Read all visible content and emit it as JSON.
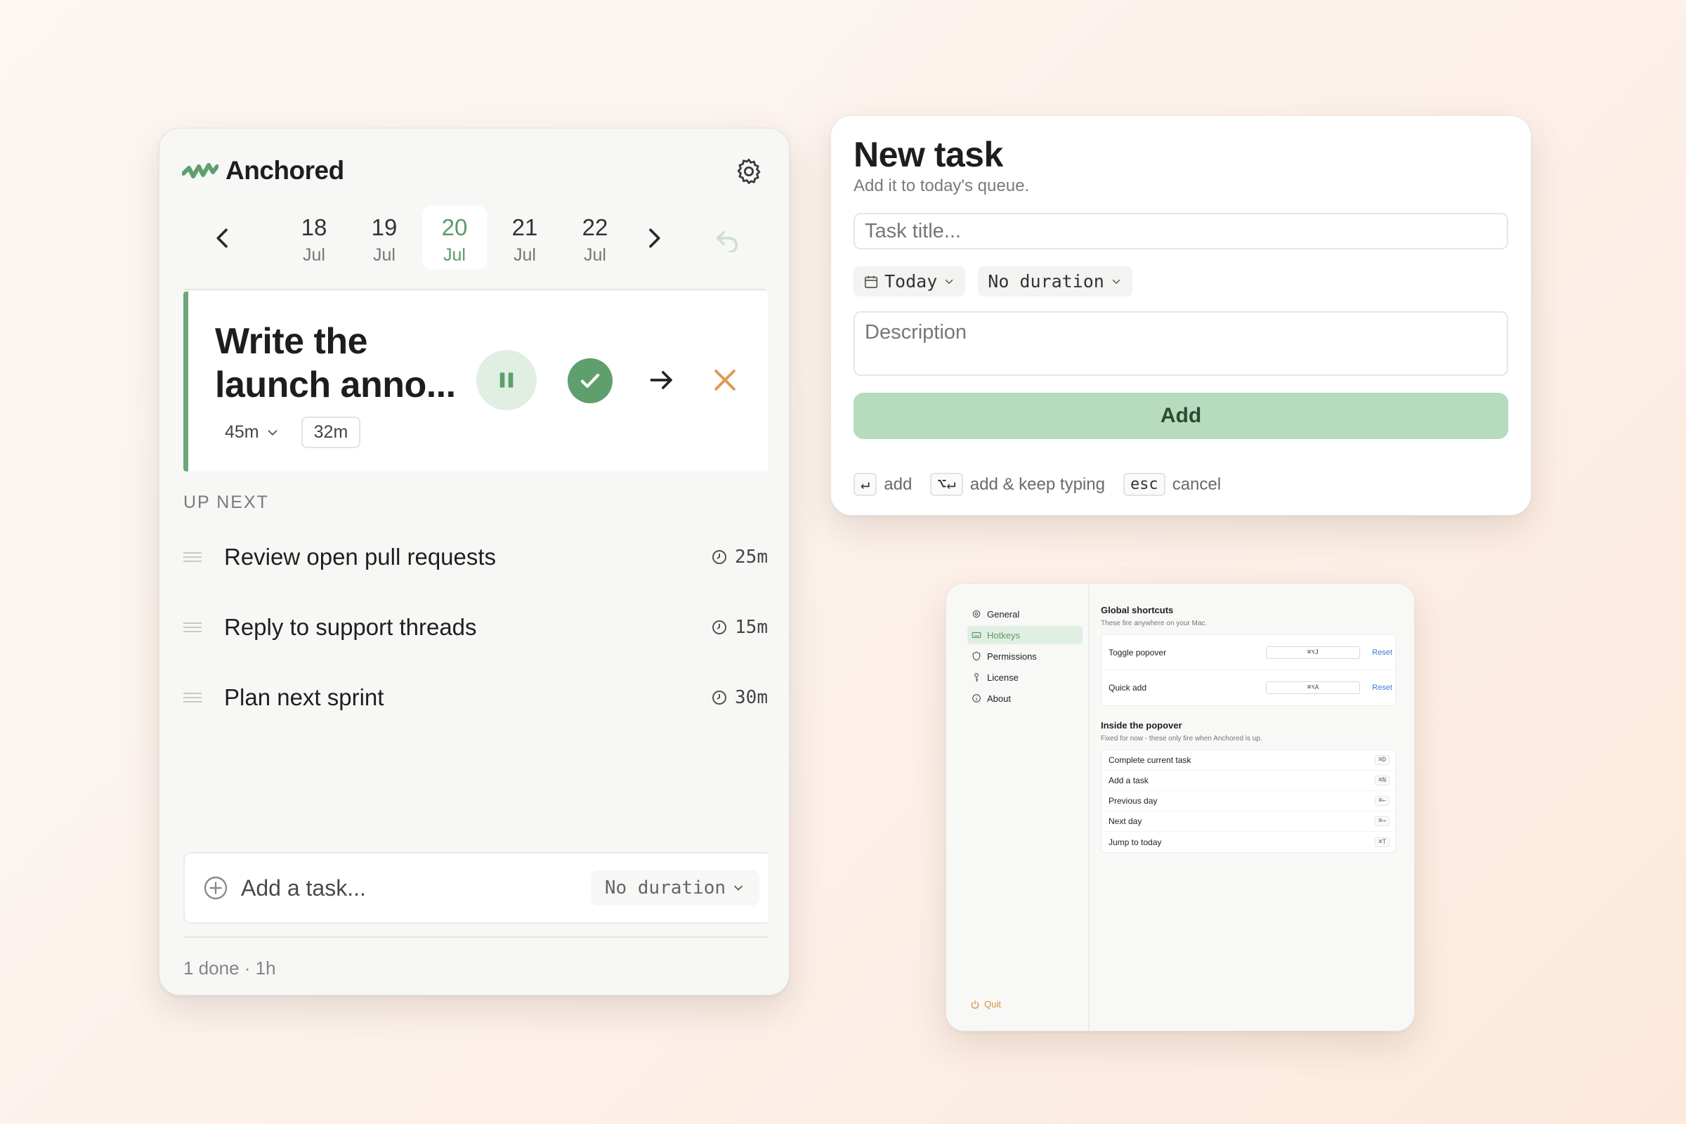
{
  "app": {
    "name": "Anchored"
  },
  "colors": {
    "accent": "#5e9f6d",
    "accent_soft": "#e1efe3",
    "skip": "#e19a55",
    "link": "#3b7bd1"
  },
  "days": [
    {
      "num": "18",
      "mon": "Jul",
      "active": false
    },
    {
      "num": "19",
      "mon": "Jul",
      "active": false
    },
    {
      "num": "20",
      "mon": "Jul",
      "active": true
    },
    {
      "num": "21",
      "mon": "Jul",
      "active": false
    },
    {
      "num": "22",
      "mon": "Jul",
      "active": false
    }
  ],
  "current_task": {
    "title": "Write the launch anno...",
    "estimate": "45m",
    "elapsed": "32m"
  },
  "queue": {
    "label": "UP NEXT",
    "items": [
      {
        "title": "Review open pull requests",
        "duration": "25m"
      },
      {
        "title": "Reply to support threads",
        "duration": "15m"
      },
      {
        "title": "Plan next sprint",
        "duration": "30m"
      }
    ]
  },
  "add_task": {
    "placeholder": "Add a task...",
    "duration": "No duration"
  },
  "footer": {
    "summary": "1 done · 1h"
  },
  "new_task": {
    "title": "New task",
    "subtitle": "Add it to today's queue.",
    "title_placeholder": "Task title...",
    "date_chip": "Today",
    "duration_chip": "No duration",
    "description_placeholder": "Description",
    "add_label": "Add",
    "hints": [
      {
        "key": "↵",
        "text": "add"
      },
      {
        "key": "⌥↵",
        "text": "add & keep typing"
      },
      {
        "key": "esc",
        "text": "cancel"
      }
    ]
  },
  "settings": {
    "nav": [
      {
        "label": "General",
        "icon": "gear-icon",
        "active": false
      },
      {
        "label": "Hotkeys",
        "icon": "keyboard-icon",
        "active": true
      },
      {
        "label": "Permissions",
        "icon": "shield-icon",
        "active": false
      },
      {
        "label": "License",
        "icon": "key-icon",
        "active": false
      },
      {
        "label": "About",
        "icon": "info-icon",
        "active": false
      }
    ],
    "quit_label": "Quit",
    "global": {
      "title": "Global shortcuts",
      "subtitle": "These fire anywhere on your Mac.",
      "rows": [
        {
          "label": "Toggle popover",
          "key": "⌘⌥J",
          "reset": "Reset"
        },
        {
          "label": "Quick add",
          "key": "⌘⌥A",
          "reset": "Reset"
        }
      ]
    },
    "popover": {
      "title": "Inside the popover",
      "subtitle": "Fixed for now - these only fire when Anchored is up.",
      "rows": [
        {
          "label": "Complete current task",
          "key": "⌘D"
        },
        {
          "label": "Add a task",
          "key": "⌘N"
        },
        {
          "label": "Previous day",
          "key": "⌘←"
        },
        {
          "label": "Next day",
          "key": "⌘→"
        },
        {
          "label": "Jump to today",
          "key": "⌘T"
        }
      ]
    }
  }
}
